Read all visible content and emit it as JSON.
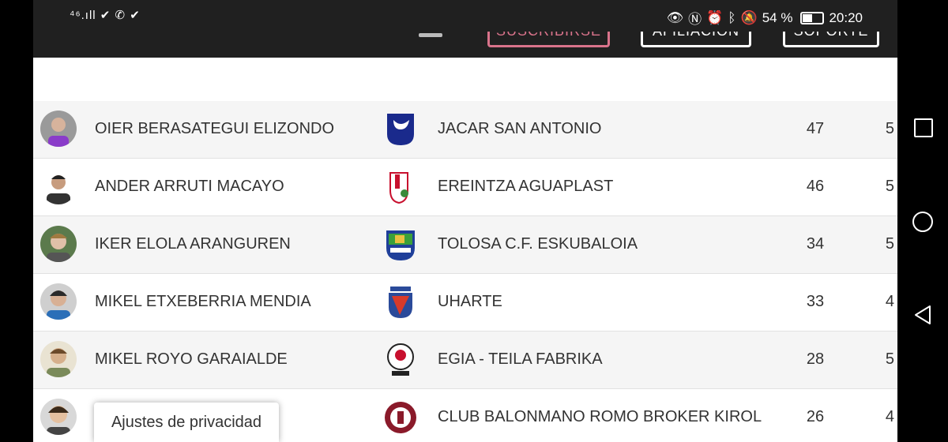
{
  "status_bar": {
    "left_icons": "⁴⁶.ıll ✔ ✆ ✔",
    "battery_percent": "54 %",
    "battery_level": 0.54,
    "time": "20:20"
  },
  "nav": {
    "subscribe": "SUSCRIBIRSE",
    "affiliation": "AFILIACIÓN",
    "support": "SOPORTE"
  },
  "rows": [
    {
      "player": "OIER BERASATEGUI ELIZONDO",
      "team": "JACAR SAN ANTONIO",
      "points": "47",
      "games": "5",
      "crest": "shield-blue"
    },
    {
      "player": "ANDER ARRUTI MACAYO",
      "team": "EREINTZA AGUAPLAST",
      "points": "46",
      "games": "5",
      "crest": "shield-red"
    },
    {
      "player": "IKER ELOLA ARANGUREN",
      "team": "TOLOSA C.F. ESKUBALOIA",
      "points": "34",
      "games": "5",
      "crest": "shield-castle"
    },
    {
      "player": "MIKEL ETXEBERRIA MENDIA",
      "team": "UHARTE",
      "points": "33",
      "games": "4",
      "crest": "shield-uharte"
    },
    {
      "player": "MIKEL ROYO GARAIALDE",
      "team": "EGIA - TEILA FABRIKA",
      "points": "28",
      "games": "5",
      "crest": "ball-egia"
    },
    {
      "player": "",
      "team": "CLUB BALONMANO ROMO BROKER KIROL",
      "points": "26",
      "games": "4",
      "crest": "seal-romo"
    }
  ],
  "privacy_label": "Ajustes de privacidad"
}
